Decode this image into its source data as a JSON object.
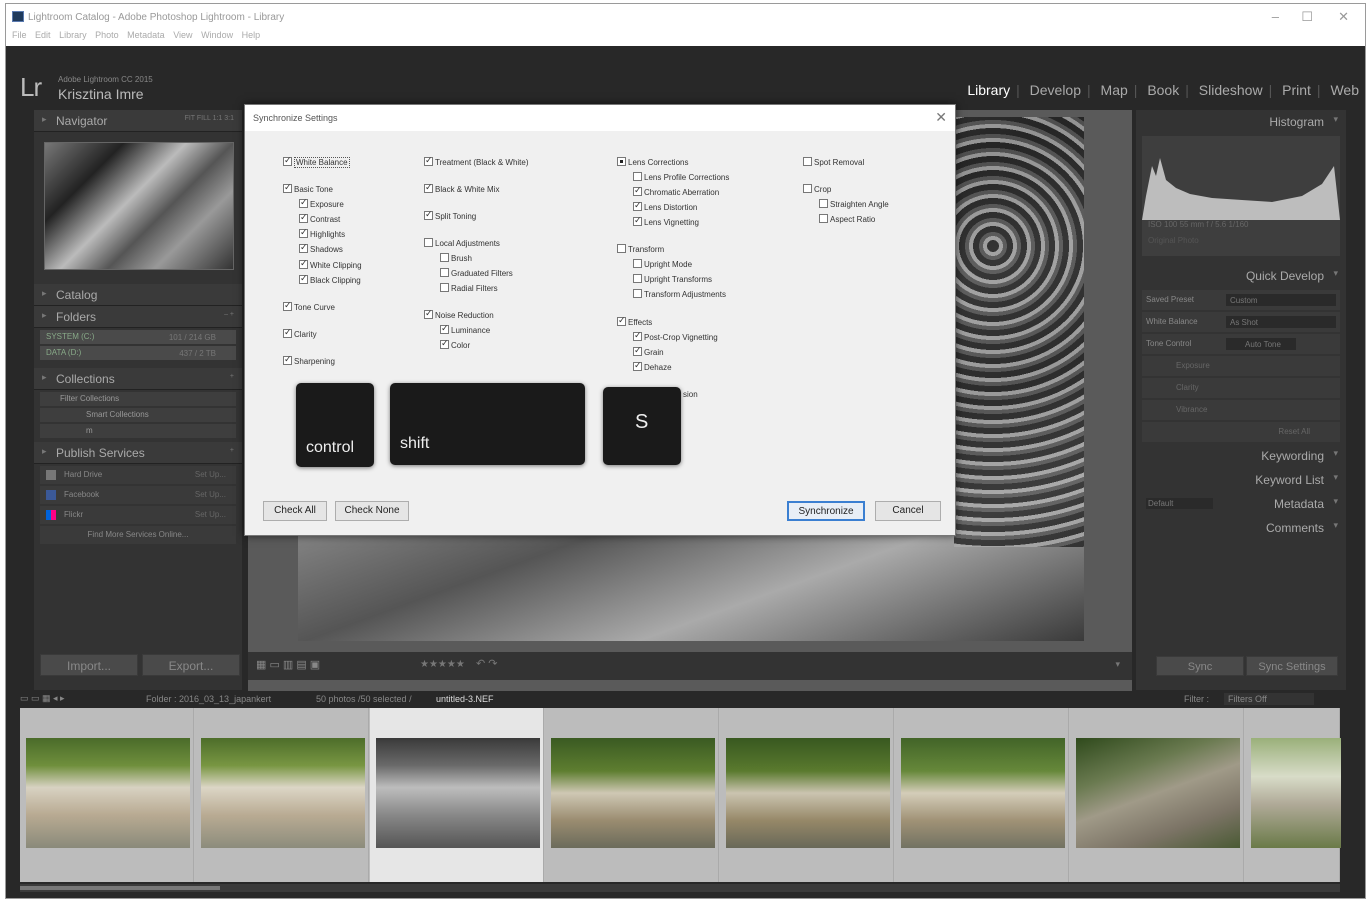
{
  "window": {
    "title": "Lightroom Catalog - Adobe Photoshop Lightroom - Library",
    "minimize": "–",
    "maximize": "☐",
    "close": "✕"
  },
  "menu": [
    "File",
    "Edit",
    "Library",
    "Photo",
    "Metadata",
    "View",
    "Window",
    "Help"
  ],
  "identity": {
    "logo": "Lr",
    "product": "Adobe Lightroom CC 2015",
    "user": "Krisztina Imre"
  },
  "modules": [
    {
      "label": "Library",
      "active": true
    },
    {
      "label": "Develop"
    },
    {
      "label": "Map"
    },
    {
      "label": "Book"
    },
    {
      "label": "Slideshow"
    },
    {
      "label": "Print"
    },
    {
      "label": "Web"
    }
  ],
  "left_panel": {
    "navigator": {
      "title": "Navigator",
      "zoom": "FIT  FILL  1:1  3:1"
    },
    "catalog": "Catalog",
    "folders": {
      "title": "Folders",
      "volumes": [
        {
          "name": "SYSTEM (C:)",
          "info": "101 / 214 GB"
        },
        {
          "name": "DATA (D:)",
          "info": "437 / 2 TB"
        }
      ]
    },
    "collections": {
      "title": "Collections",
      "items": [
        "Filter Collections",
        "Smart Collections",
        "m"
      ]
    },
    "publish": {
      "title": "Publish Services",
      "services": [
        {
          "name": "Hard Drive",
          "action": "Set Up..."
        },
        {
          "name": "Facebook",
          "action": "Set Up..."
        },
        {
          "name": "Flickr",
          "action": "Set Up..."
        }
      ],
      "find_more": "Find More Services Online..."
    },
    "import_label": "Import...",
    "export_label": "Export..."
  },
  "right_panel": {
    "histogram": {
      "title": "Histogram",
      "info": "ISO 100      55 mm      f / 5.6      1/160",
      "orig": "Original Photo"
    },
    "quick_develop": {
      "title": "Quick Develop",
      "saved_preset": {
        "label": "Saved Preset",
        "value": "Custom"
      },
      "white_balance": {
        "label": "White Balance",
        "value": "As Shot"
      },
      "tone_control": {
        "label": "Tone Control",
        "value": "Auto Tone"
      },
      "exposure": "Exposure",
      "clarity": "Clarity",
      "vibrance": "Vibrance",
      "reset": "Reset All"
    },
    "keywording": "Keywording",
    "keyword_list": "Keyword List",
    "metadata": {
      "title": "Metadata",
      "preset": "Default"
    },
    "comments": "Comments",
    "sync_label": "Sync",
    "sync_settings_label": "Sync Settings"
  },
  "dialog": {
    "title": "Synchronize Settings",
    "close": "✕",
    "col1": [
      {
        "label": "White Balance",
        "checked": true,
        "selected": true
      },
      {
        "label": "Basic Tone",
        "checked": true
      },
      {
        "label": "Exposure",
        "checked": true
      },
      {
        "label": "Contrast",
        "checked": true
      },
      {
        "label": "Highlights",
        "checked": true
      },
      {
        "label": "Shadows",
        "checked": true
      },
      {
        "label": "White Clipping",
        "checked": true
      },
      {
        "label": "Black Clipping",
        "checked": true
      },
      {
        "label": "Tone Curve",
        "checked": true
      },
      {
        "label": "Clarity",
        "checked": true
      },
      {
        "label": "Sharpening",
        "checked": true
      }
    ],
    "col2": [
      {
        "label": "Treatment (Black & White)",
        "checked": true
      },
      {
        "label": "Black & White Mix",
        "checked": true
      },
      {
        "label": "Split Toning",
        "checked": true
      },
      {
        "label": "Local Adjustments",
        "checked": false
      },
      {
        "label": "Brush",
        "checked": false
      },
      {
        "label": "Graduated Filters",
        "checked": false
      },
      {
        "label": "Radial Filters",
        "checked": false
      },
      {
        "label": "Noise Reduction",
        "checked": true
      },
      {
        "label": "Luminance",
        "checked": true
      },
      {
        "label": "Color",
        "checked": true
      }
    ],
    "col3": [
      {
        "label": "Lens Corrections",
        "state": "mixed"
      },
      {
        "label": "Lens Profile Corrections",
        "checked": false
      },
      {
        "label": "Chromatic Aberration",
        "checked": true
      },
      {
        "label": "Lens Distortion",
        "checked": true
      },
      {
        "label": "Lens Vignetting",
        "checked": true
      },
      {
        "label": "Transform",
        "checked": false
      },
      {
        "label": "Upright Mode",
        "checked": false
      },
      {
        "label": "Upright Transforms",
        "checked": false
      },
      {
        "label": "Transform Adjustments",
        "checked": false
      },
      {
        "label": "Effects",
        "checked": true
      },
      {
        "label": "Post-Crop Vignetting",
        "checked": true
      },
      {
        "label": "Grain",
        "checked": true
      },
      {
        "label": "Dehaze",
        "checked": true
      }
    ],
    "col3_partial": "sion",
    "col4": [
      {
        "label": "Spot Removal",
        "checked": false
      },
      {
        "label": "Crop",
        "checked": false
      },
      {
        "label": "Straighten Angle",
        "checked": false
      },
      {
        "label": "Aspect Ratio",
        "checked": false
      }
    ],
    "keys": [
      "control",
      "shift",
      "S"
    ],
    "check_all": "Check All",
    "check_none": "Check None",
    "synchronize": "Synchronize",
    "cancel": "Cancel"
  },
  "filmbar": {
    "folder": "Folder : 2016_03_13_japankert",
    "count": "50 photos /50 selected /",
    "file": "untitled-3.NEF",
    "filter_label": "Filter :",
    "filter_value": "Filters Off"
  },
  "toolbar": {
    "stars": "★★★★★"
  },
  "thumbnails": [
    {
      "tone": "color",
      "selected": false
    },
    {
      "tone": "color",
      "selected": false
    },
    {
      "tone": "bw",
      "selected": true
    },
    {
      "tone": "color",
      "selected": false
    },
    {
      "tone": "color",
      "selected": false
    },
    {
      "tone": "color",
      "selected": false
    },
    {
      "tone": "color",
      "selected": false
    },
    {
      "tone": "color",
      "selected": false
    }
  ]
}
